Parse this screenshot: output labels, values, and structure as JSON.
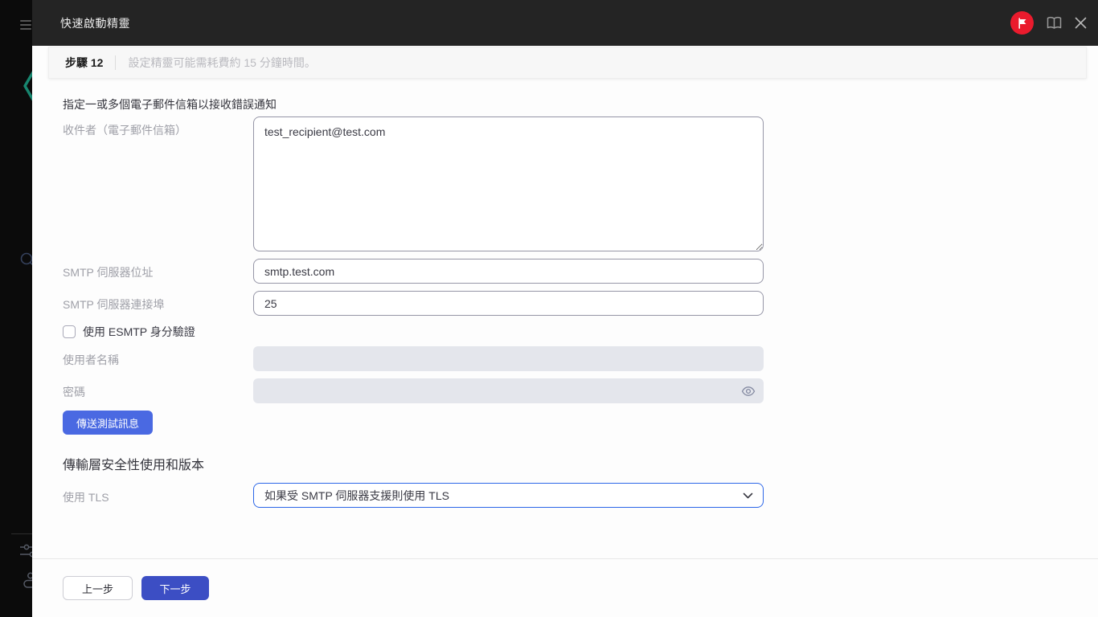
{
  "topbar": {
    "title": "快速啟動精靈"
  },
  "stepbar": {
    "step_label": "步驟 12",
    "description": "設定精靈可能需耗費約 15 分鐘時間。"
  },
  "form": {
    "intro": "指定一或多個電子郵件信箱以接收錯誤通知",
    "recipients": {
      "label": "收件者（電子郵件信箱）",
      "value": "test_recipient@test.com"
    },
    "smtp_address": {
      "label": "SMTP 伺服器位址",
      "value": "smtp.test.com"
    },
    "smtp_port": {
      "label": "SMTP 伺服器連接埠",
      "value": "25"
    },
    "esmtp_checkbox": {
      "label": "使用 ESMTP 身分驗證",
      "checked": false
    },
    "username": {
      "label": "使用者名稱",
      "value": ""
    },
    "password": {
      "label": "密碼",
      "value": ""
    },
    "send_test_button": "傳送測試訊息",
    "tls_section_title": "傳輸層安全性使用和版本",
    "tls": {
      "label": "使用 TLS",
      "selected": "如果受 SMTP 伺服器支援則使用 TLS"
    }
  },
  "footer": {
    "back_button": "上一步",
    "next_button": "下一步"
  },
  "colors": {
    "accent_blue": "#4a69e2",
    "next_blue": "#3c4ec4",
    "focus_border": "#2b66e8",
    "flag_red": "#ea1b2d",
    "topbar_bg": "#242424",
    "rail_bg": "#0b0b0b",
    "logo_teal": "#17866f"
  }
}
